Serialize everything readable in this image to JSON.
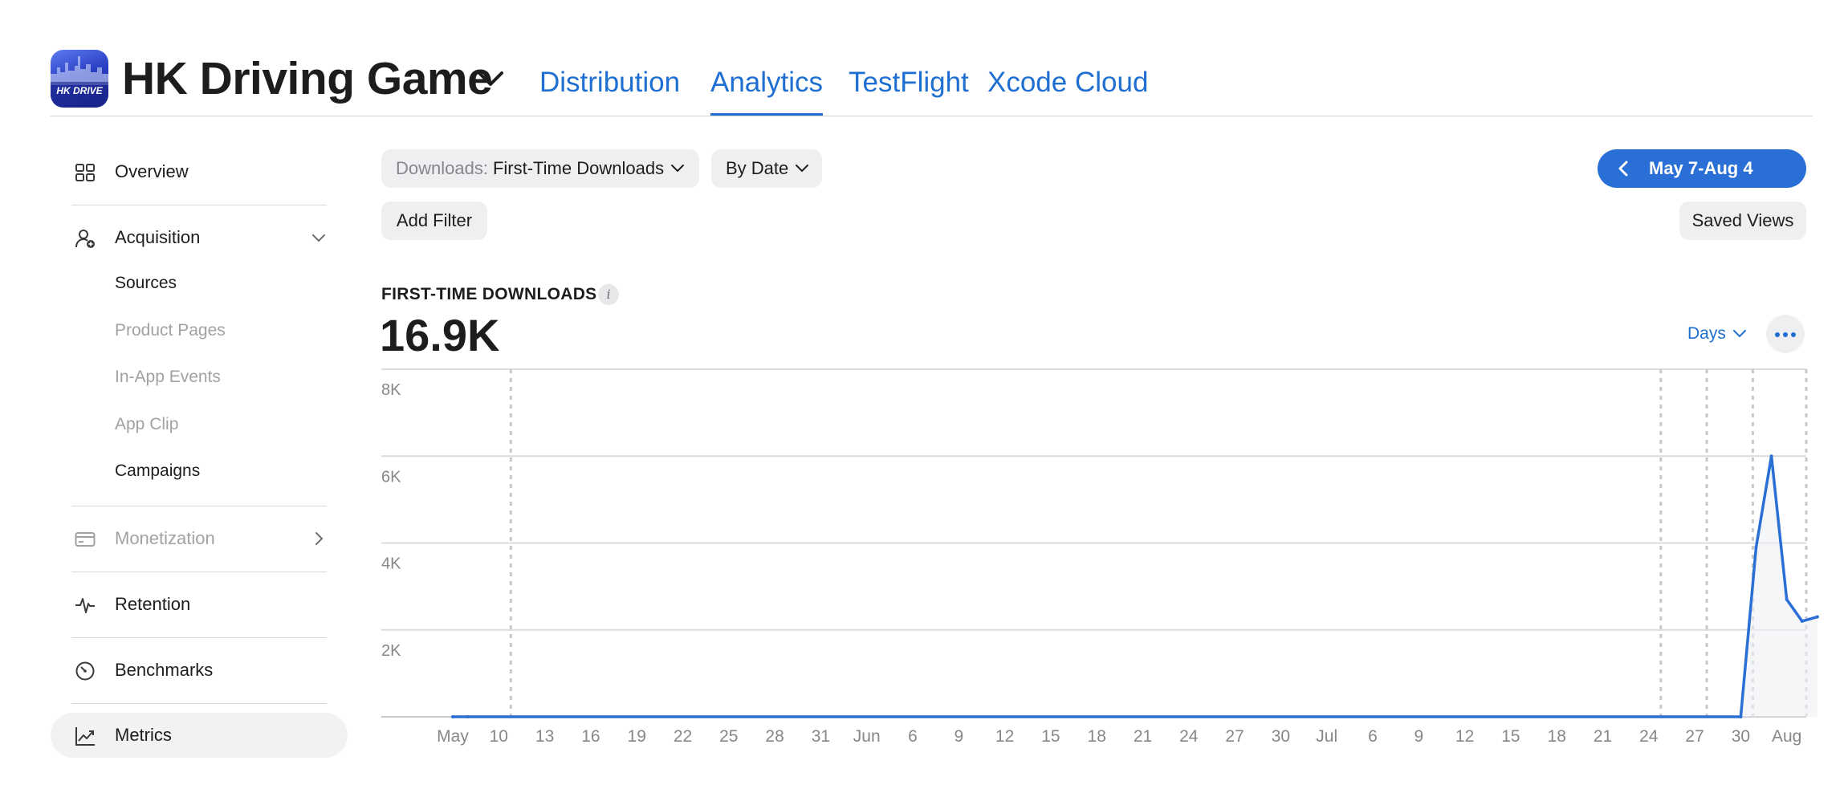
{
  "app": {
    "name": "HK Driving Game",
    "icon_text": "HK DRIVE"
  },
  "tabs": [
    {
      "label": "Distribution",
      "active": false
    },
    {
      "label": "Analytics",
      "active": true
    },
    {
      "label": "TestFlight",
      "active": false
    },
    {
      "label": "Xcode Cloud",
      "active": false
    }
  ],
  "sidebar": {
    "overview": "Overview",
    "acquisition": "Acquisition",
    "acquisition_items": [
      "Sources",
      "Product Pages",
      "In-App Events",
      "App Clip",
      "Campaigns"
    ],
    "monetization": "Monetization",
    "retention": "Retention",
    "benchmarks": "Benchmarks",
    "metrics": "Metrics"
  },
  "toolbar": {
    "measure_prefix": "Downloads:",
    "measure_value": "First-Time Downloads",
    "group_by": "By Date",
    "date_range": "May 7-Aug 4",
    "add_filter": "Add Filter",
    "saved_views": "Saved Views"
  },
  "metric": {
    "label": "FIRST-TIME DOWNLOADS",
    "info_icon_text": "i",
    "value": "16.9K",
    "granularity": "Days"
  },
  "colors": {
    "accent": "#1e6fd1",
    "line": "#2a6fd6",
    "grid": "#dcdcdf"
  },
  "chart_data": {
    "type": "line",
    "y_ticks": [
      "8K",
      "6K",
      "4K",
      "2K"
    ],
    "ylim": [
      0,
      8000
    ],
    "x_tick_labels": [
      "May",
      "10",
      "13",
      "16",
      "19",
      "22",
      "25",
      "28",
      "31",
      "Jun",
      "6",
      "9",
      "12",
      "15",
      "18",
      "21",
      "24",
      "27",
      "30",
      "Jul",
      "6",
      "9",
      "12",
      "15",
      "18",
      "21",
      "24",
      "27",
      "30",
      "Aug"
    ],
    "dotted_marker_tick_indices": [
      1,
      26,
      27,
      28
    ],
    "series": [
      {
        "x": [
          "May 7",
          "May 8",
          "Jul 30",
          "Jul 31",
          "Aug 1",
          "Aug 2",
          "Aug 3",
          "Aug 4"
        ],
        "values": [
          0,
          0,
          0,
          3900,
          6000,
          2700,
          2200,
          2300
        ]
      }
    ]
  }
}
